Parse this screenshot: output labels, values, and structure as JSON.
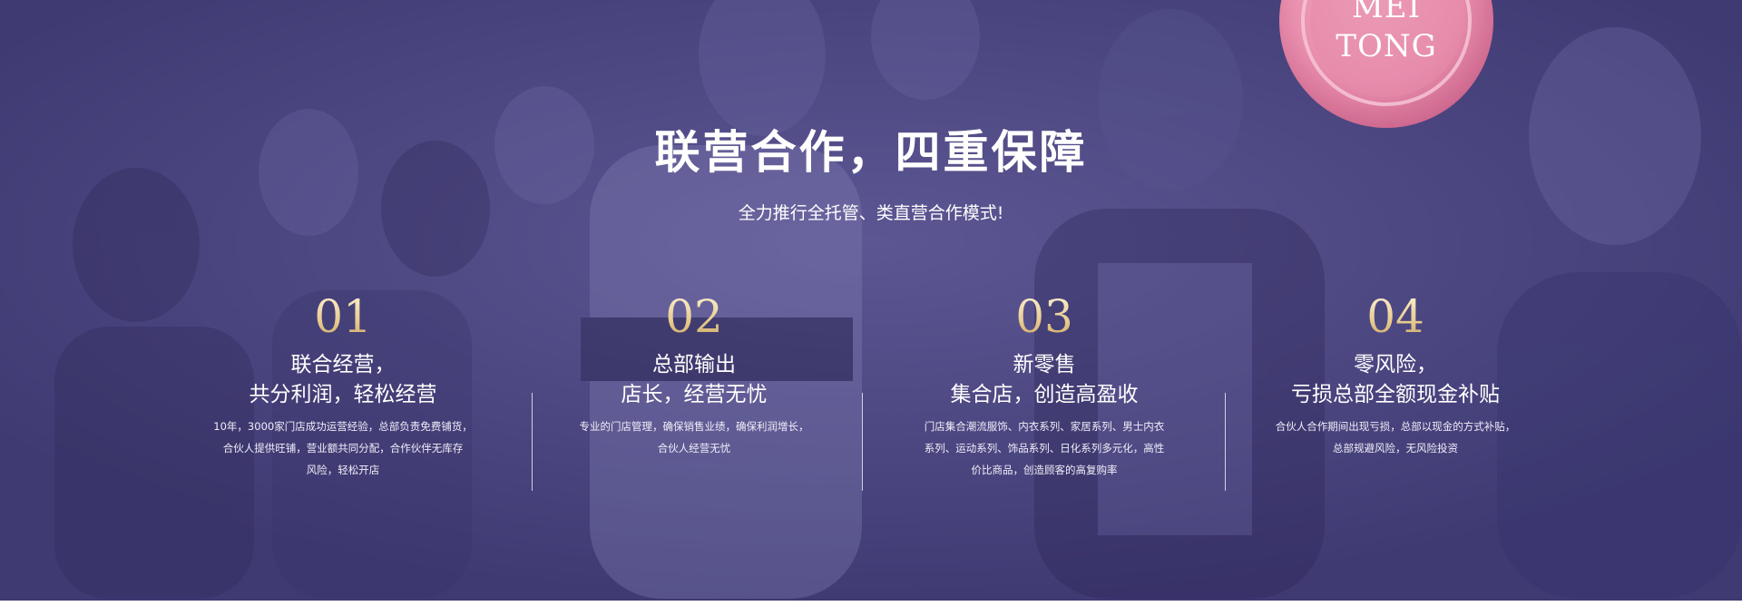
{
  "title": "联营合作，四重保障",
  "subtitle": "全力推行全托管、类直营合作模式!",
  "seal": {
    "line1": "MEI",
    "line2": "TONG"
  },
  "colors": {
    "background": "#4a4580",
    "accent_gold": "#e7c98c",
    "seal_pink": "#e98fae",
    "text": "#ffffff"
  },
  "features": [
    {
      "number": "01",
      "heading1": "联合经营，",
      "heading2": "共分利润，轻松经营",
      "desc1": "10年，3000家门店成功运营经验，总部负责免费铺货，",
      "desc2": "合伙人提供旺铺，营业额共同分配，合作伙伴无库存",
      "desc3": "风险，轻松开店"
    },
    {
      "number": "02",
      "heading1": "总部输出",
      "heading2": "店长，经营无忧",
      "desc1": "专业的门店管理，确保销售业绩，确保利润增长，",
      "desc2": "合伙人经营无忧",
      "desc3": ""
    },
    {
      "number": "03",
      "heading1": "新零售",
      "heading2": "集合店，创造高盈收",
      "desc1": "门店集合潮流服饰、内衣系列、家居系列、男士内衣",
      "desc2": "系列、运动系列、饰品系列、日化系列多元化，高性",
      "desc3": "价比商品，创造顾客的高复购率"
    },
    {
      "number": "04",
      "heading1": "零风险，",
      "heading2": "亏损总部全额现金补贴",
      "desc1": "合伙人合作期间出现亏损，总部以现金的方式补贴，",
      "desc2": "总部规避风险，无风险投资",
      "desc3": ""
    }
  ]
}
